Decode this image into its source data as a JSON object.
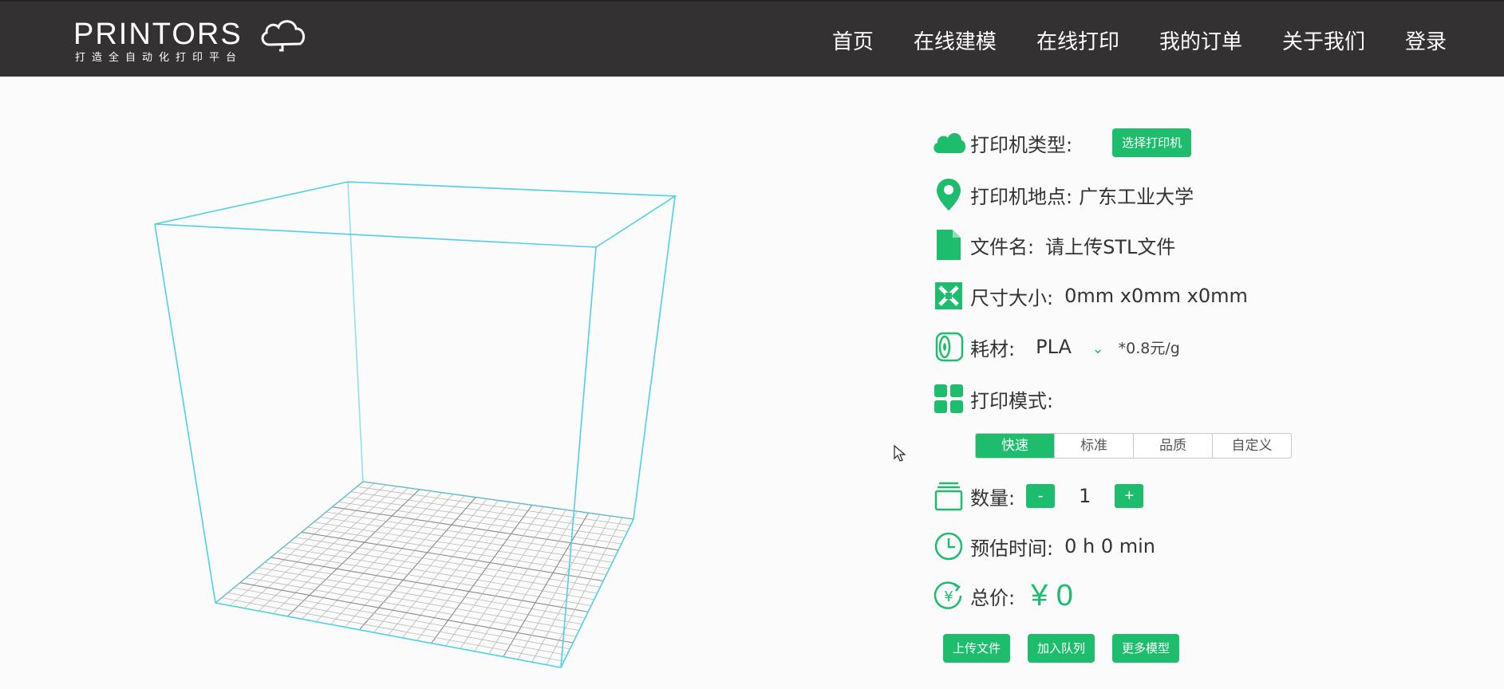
{
  "header": {
    "logo_text": "PRINTORS",
    "logo_slogan": "打造全自动化打印平台",
    "nav": [
      "首页",
      "在线建模",
      "在线打印",
      "我的订单",
      "关于我们",
      "登录"
    ]
  },
  "panel": {
    "printer_type_label": "打印机类型:",
    "select_printer_button": "选择打印机",
    "printer_location_label": "打印机地点:",
    "printer_location_value": "广东工业大学",
    "filename_label": "文件名:",
    "filename_value": "请上传STL文件",
    "size_label": "尺寸大小:",
    "size_value": "0mm x0mm x0mm",
    "material_label": "耗材:",
    "material_value": "PLA",
    "material_price": "*0.8元/g",
    "mode_label": "打印模式:",
    "modes": [
      "快速",
      "标准",
      "品质",
      "自定义"
    ],
    "active_mode": "快速",
    "quantity_label": "数量:",
    "quantity_minus": "-",
    "quantity_value": "1",
    "quantity_plus": "+",
    "time_label": "预估时间:",
    "time_value": "0 h 0 min",
    "total_label": "总价:",
    "total_value": "¥ 0"
  },
  "actions": {
    "upload": "上传文件",
    "enqueue": "加入队列",
    "more_models": "更多模型"
  },
  "colors": {
    "accent": "#1ebd6e",
    "header_bg": "#333131",
    "wire": "#4fd0e6"
  }
}
